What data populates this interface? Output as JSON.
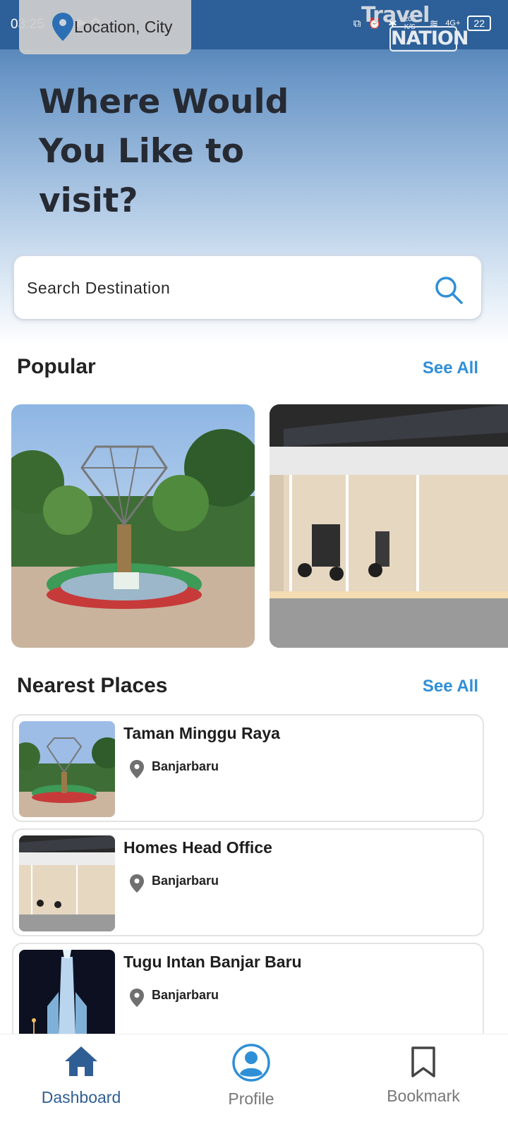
{
  "status_bar": {
    "time": "03:25",
    "battery": "22",
    "network": "4G+",
    "speed": "206 K/S"
  },
  "header": {
    "location_label": "Location, City",
    "logo_line1": "Travel",
    "logo_line2": "NATION",
    "headline_line1": "Where Would",
    "headline_line2": "You Like to",
    "headline_line3": "visit?"
  },
  "search": {
    "placeholder": "Search Destination"
  },
  "popular": {
    "title": "Popular",
    "see_all": "See All"
  },
  "nearest": {
    "title": "Nearest Places",
    "see_all": "See All",
    "items": [
      {
        "name": "Taman Minggu Raya",
        "city": "Banjarbaru"
      },
      {
        "name": "Homes Head Office",
        "city": "Banjarbaru"
      },
      {
        "name": "Tugu Intan Banjar Baru",
        "city": "Banjarbaru"
      }
    ]
  },
  "bottom_nav": {
    "items": [
      {
        "label": "Dashboard",
        "icon": "home-icon",
        "active": true
      },
      {
        "label": "Profile",
        "icon": "profile-icon",
        "active": false
      },
      {
        "label": "Bookmark",
        "icon": "bookmark-icon",
        "active": false
      }
    ]
  },
  "colors": {
    "accent": "#2f8fd6",
    "nav_active": "#2f5e94",
    "status_bar": "#2d5f98"
  }
}
